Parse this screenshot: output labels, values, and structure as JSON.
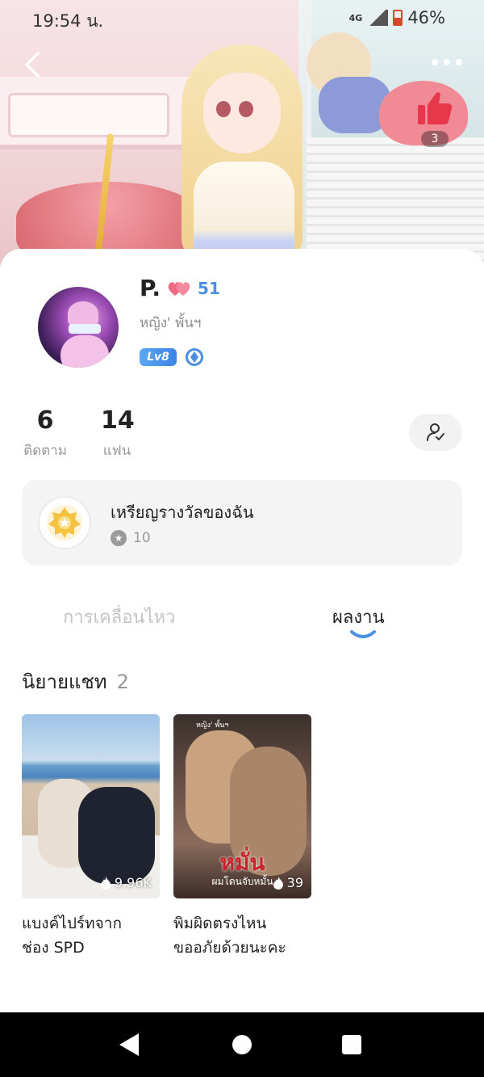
{
  "status_bar": {
    "time": "19:54 น.",
    "network": "4G",
    "battery": "46%"
  },
  "header": {
    "back_icon": "chevron-left-icon",
    "more_icon": "more-dots-icon",
    "like_count": "3"
  },
  "profile": {
    "name": "P.",
    "heart_count": "51",
    "subtitle": "หญิง' พั้นฯ",
    "level": "Lv8"
  },
  "stats": {
    "following_count": "6",
    "following_label": "ติดตาม",
    "fans_count": "14",
    "fans_label": "แฟน"
  },
  "medals": {
    "title": "เหรียญรางวัลของฉัน",
    "count": "10"
  },
  "tabs": [
    {
      "label": "การเคลื่อนไหว",
      "active": false
    },
    {
      "label": "ผลงาน",
      "active": true
    }
  ],
  "section": {
    "title": "นิยายแชท",
    "count": "2"
  },
  "books": [
    {
      "title_line1": "แบงค์ไปร์ทจาก",
      "title_line2": "ช่อง SPD",
      "views": "9.96K"
    },
    {
      "title_line1": "พิมผิดตรงไหน",
      "title_line2": "ขออภัยด้วยนะคะ",
      "views": "39",
      "cover_title": "หมั่น",
      "cover_sub": "ผมโดนจับหมั้น",
      "cover_mark": "หญิง' พั้นฯ"
    }
  ],
  "colors": {
    "accent": "#4a8fe0",
    "like": "#e8364a"
  }
}
